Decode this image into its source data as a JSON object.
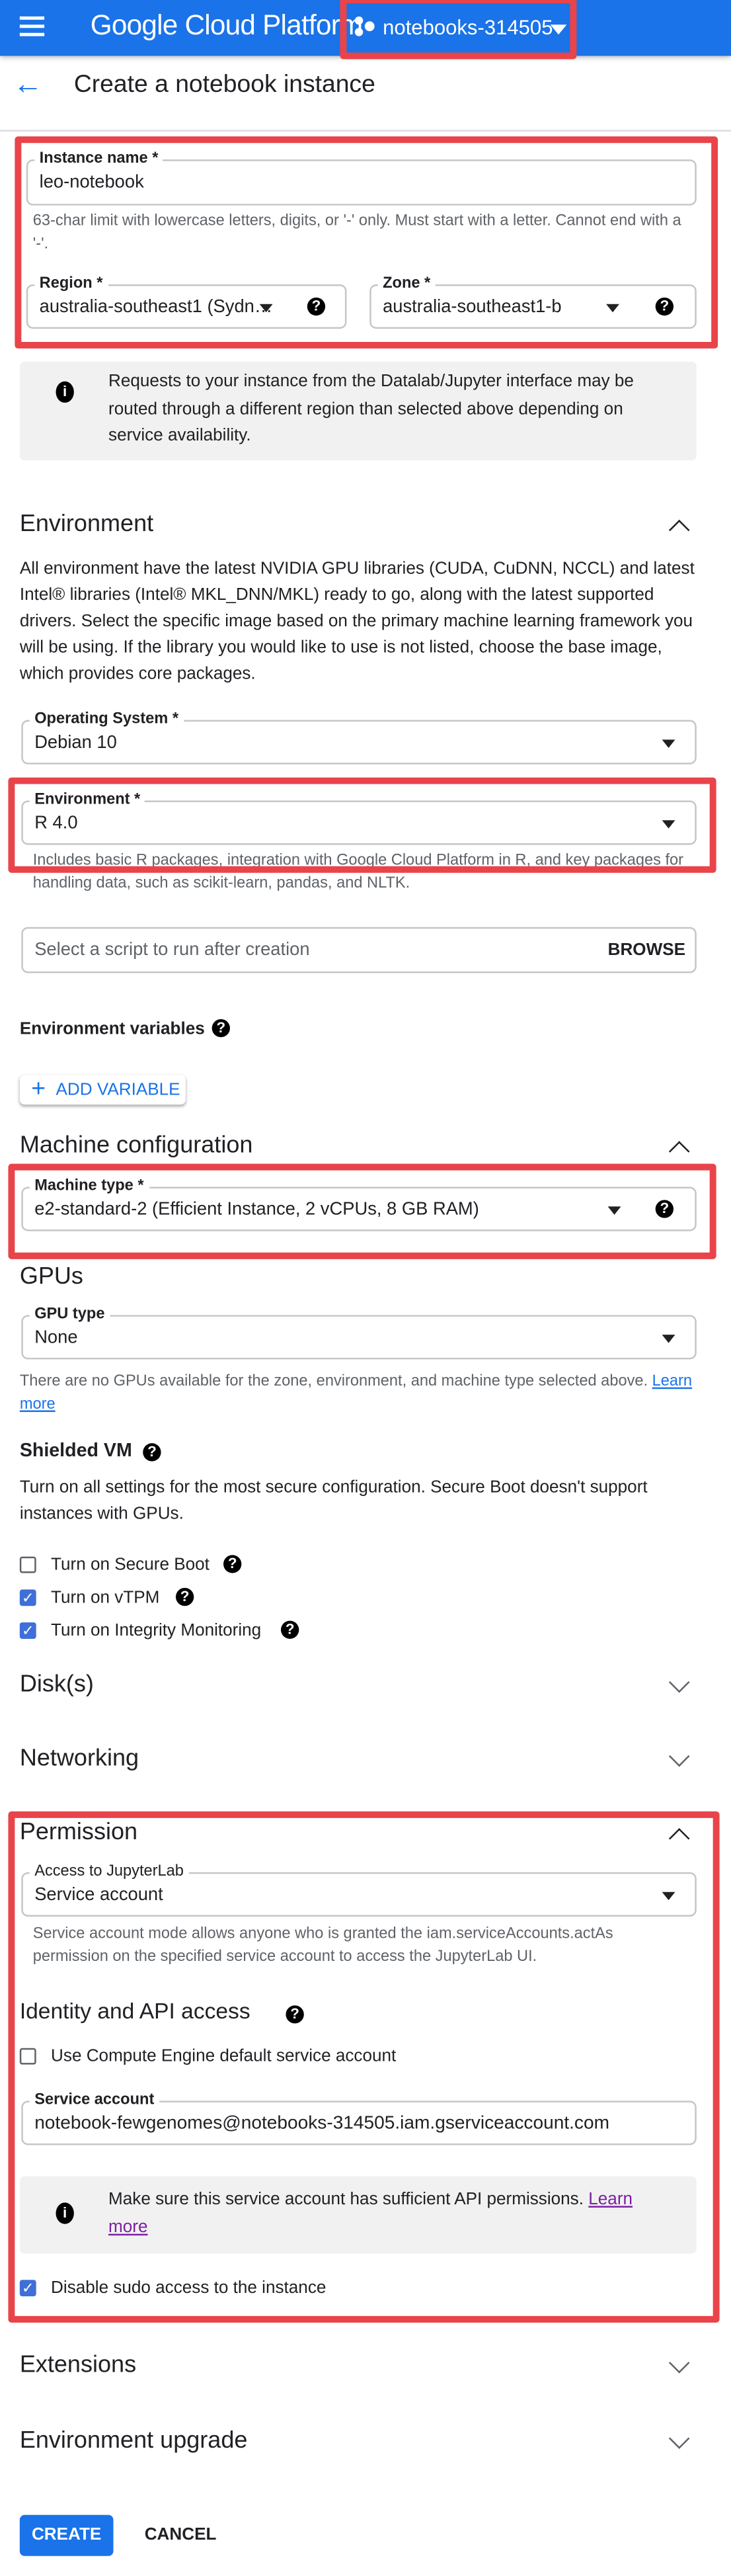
{
  "header": {
    "menu_icon": "hamburger-icon",
    "brand": "Google Cloud Platform",
    "project": "notebooks-314505",
    "accent": "#1a73e8"
  },
  "page": {
    "title": "Create a notebook instance"
  },
  "instance": {
    "name_label": "Instance name *",
    "name_value": "leo-notebook",
    "name_helper": "63-char limit with lowercase letters, digits, or '-' only. Must start with a letter. Cannot end with a '-'.",
    "region_label": "Region *",
    "region_value": "australia-southeast1 (Sydn…",
    "zone_label": "Zone *",
    "zone_value": "australia-southeast1-b",
    "info": "Requests to your instance from the Datalab/Jupyter interface may be routed through a different region than selected above depending on service availability."
  },
  "environment": {
    "heading": "Environment",
    "description": "All environment have the latest NVIDIA GPU libraries (CUDA, CuDNN, NCCL) and latest Intel® libraries (Intel® MKL_DNN/MKL) ready to go, along with the latest supported drivers. Select the specific image based on the primary machine learning framework you will be using. If the library you would like to use is not listed, choose the base image, which provides core packages.",
    "os_label": "Operating System *",
    "os_value": "Debian 10",
    "env_label": "Environment *",
    "env_value": "R 4.0",
    "env_helper": "Includes basic R packages, integration with Google Cloud Platform in R, and key packages for handling data, such as scikit-learn, pandas, and NLTK.",
    "script_placeholder": "Select a script to run after creation",
    "browse": "BROWSE",
    "variables_label": "Environment variables",
    "add_variable": "ADD VARIABLE"
  },
  "machine": {
    "heading": "Machine configuration",
    "type_label": "Machine type *",
    "type_value": "e2-standard-2 (Efficient Instance, 2 vCPUs, 8 GB RAM)",
    "gpus_heading": "GPUs",
    "gpu_label": "GPU type",
    "gpu_value": "None",
    "gpu_helper": "There are no GPUs available for the zone, environment, and machine type selected above.",
    "gpu_learn": "Learn more",
    "shielded_heading": "Shielded VM",
    "shielded_desc": "Turn on all settings for the most secure configuration. Secure Boot doesn't support instances with GPUs.",
    "checkboxes": [
      {
        "label": "Turn on Secure Boot",
        "checked": false
      },
      {
        "label": "Turn on vTPM",
        "checked": true
      },
      {
        "label": "Turn on Integrity Monitoring",
        "checked": true
      }
    ]
  },
  "sections": {
    "disks": "Disk(s)",
    "networking": "Networking",
    "extensions": "Extensions",
    "upgrade": "Environment upgrade"
  },
  "permission": {
    "heading": "Permission",
    "access_label": "Access to JupyterLab",
    "access_value": "Service account",
    "access_helper": "Service account mode allows anyone who is granted the iam.serviceAccounts.actAs permission on the specified service account to access the JupyterLab UI.",
    "identity_heading": "Identity and API access",
    "default_sa_label": "Use Compute Engine default service account",
    "default_sa_checked": false,
    "sa_label": "Service account",
    "sa_value": "notebook-fewgenomes@notebooks-314505.iam.gserviceaccount.com",
    "sa_info": "Make sure this service account has sufficient API permissions.",
    "sa_learn": "Learn more",
    "sudo_label": "Disable sudo access to the instance",
    "sudo_checked": true
  },
  "actions": {
    "create": "CREATE",
    "cancel": "CANCEL"
  },
  "highlight_color": "#e8444a"
}
